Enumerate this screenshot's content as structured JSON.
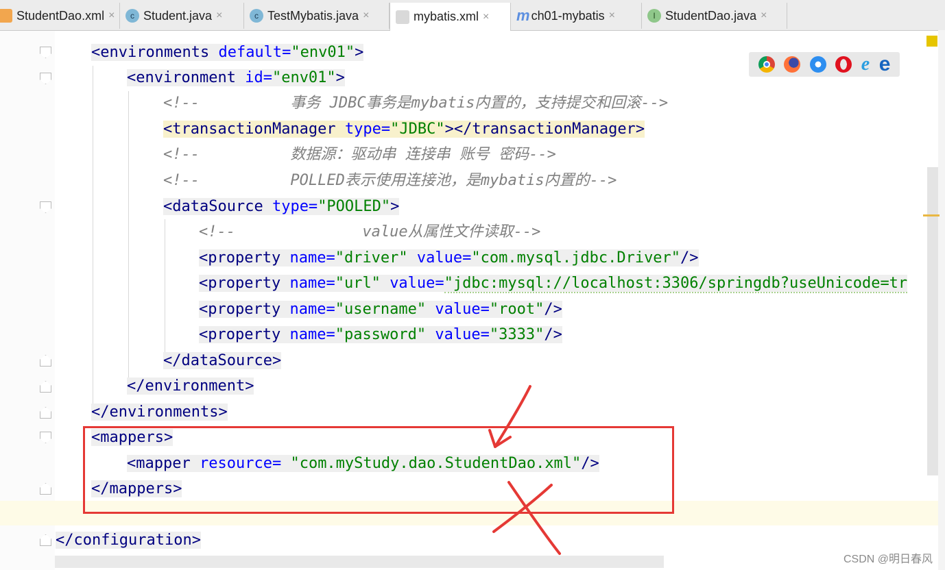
{
  "tabs": [
    {
      "label": "StudentDao.xml",
      "icon": "xml-file-icon"
    },
    {
      "label": "Student.java",
      "icon": "class-icon"
    },
    {
      "label": "TestMybatis.java",
      "icon": "class-icon"
    },
    {
      "label": "mybatis.xml",
      "icon": "xml-file-icon",
      "active": true
    },
    {
      "label": "ch01-mybatis",
      "icon": "maven-module-icon"
    },
    {
      "label": "StudentDao.java",
      "icon": "interface-icon"
    }
  ],
  "tab_close_glyph": "×",
  "code": {
    "l1_tag": "environments",
    "l1_attr": "default=",
    "l1_val": "\"env01\"",
    "l2_tag": "environment",
    "l2_attr": "id=",
    "l2_val": "\"env01\"",
    "c1": "<!--          事务 JDBC事务是mybatis内置的，支持提交和回滚-->",
    "l4_tag": "transactionManager",
    "l4_attr": "type=",
    "l4_val": "\"JDBC\"",
    "l4_close": "transactionManager",
    "c2": "<!--          数据源：驱动串 连接串 账号 密码-->",
    "c3": "<!--          POLLED表示使用连接池，是mybatis内置的-->",
    "l7_tag": "dataSource",
    "l7_attr": "type=",
    "l7_val": "\"POOLED\"",
    "c4": "<!--              value从属性文件读取-->",
    "p1_name": "\"driver\"",
    "p1_value": "\"com.mysql.jdbc.Driver\"",
    "p2_name": "\"url\"",
    "p2_value": "\"jdbc:mysql://localhost:3306/springdb?useUnicode=tr",
    "p3_name": "\"username\"",
    "p3_value": "\"root\"",
    "p4_name": "\"password\"",
    "p4_value": "\"3333\"",
    "property_tag": "property",
    "name_attr": "name=",
    "value_attr": "value=",
    "ds_close": "dataSource",
    "env_close": "environment",
    "envs_close": "environments",
    "mappers_tag": "mappers",
    "mapper_tag": "mapper",
    "mapper_attr": "resource=",
    "mapper_val": "\"com.myStudy.dao.StudentDao.xml\"",
    "config_close": "configuration"
  },
  "browser_icons": [
    "chrome-icon",
    "firefox-icon",
    "safari-icon",
    "opera-icon",
    "ie-icon",
    "edge-icon"
  ],
  "annotation_color": "#e53935",
  "watermark": "CSDN @明日春风"
}
